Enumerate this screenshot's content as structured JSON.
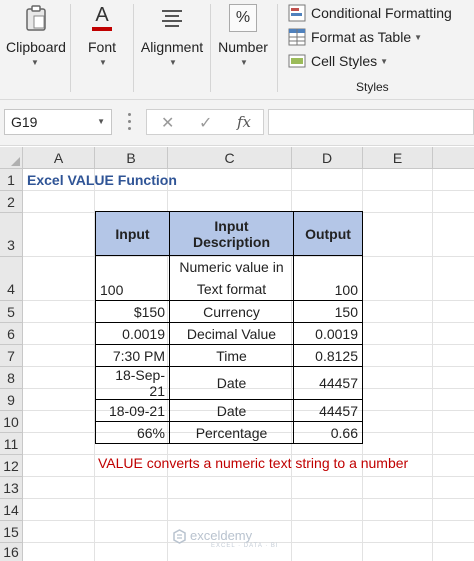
{
  "ribbon": {
    "groups": [
      {
        "label": "Clipboard",
        "icon": "clipboard-icon"
      },
      {
        "label": "Font",
        "icon": "font-icon"
      },
      {
        "label": "Alignment",
        "icon": "alignment-icon"
      },
      {
        "label": "Number",
        "icon": "percent-icon"
      }
    ],
    "styles": {
      "items": [
        "Conditional Formatting",
        "Format as Table",
        "Cell Styles"
      ],
      "group_label": "Styles"
    },
    "font_glyph": "A",
    "number_glyph": "%"
  },
  "formula_bar": {
    "name_box": "G19",
    "cancel_glyph": "✕",
    "enter_glyph": "✓",
    "fx_label": "fx",
    "formula": ""
  },
  "grid": {
    "columns": [
      "A",
      "B",
      "C",
      "D",
      "E"
    ],
    "rows": [
      "1",
      "2",
      "3",
      "4",
      "5",
      "6",
      "7",
      "8",
      "9",
      "10",
      "11",
      "12",
      "13",
      "14",
      "15",
      "16"
    ],
    "title": "Excel VALUE Function",
    "note": "VALUE converts a numeric text string to a number",
    "table": {
      "headers": [
        "Input",
        "Input Description",
        "Output"
      ],
      "rows": [
        {
          "input": "100",
          "desc_line1": "Numeric value in",
          "desc_line2": "Text format",
          "output": "100"
        },
        {
          "input": "$150",
          "desc": "Currency",
          "output": "150"
        },
        {
          "input": "0.0019",
          "desc": "Decimal Value",
          "output": "0.0019"
        },
        {
          "input": "7:30 PM",
          "desc": "Time",
          "output": "0.8125"
        },
        {
          "input": "18-Sep-21",
          "desc": "Date",
          "output": "44457"
        },
        {
          "input": "18-09-21",
          "desc": "Date",
          "output": "44457"
        },
        {
          "input": "66%",
          "desc": "Percentage",
          "output": "0.66"
        }
      ]
    }
  },
  "watermark": {
    "name": "exceldemy",
    "tagline": "EXCEL · DATA · BI"
  },
  "colors": {
    "title": "#2f5496",
    "note": "#c00000",
    "header_fill": "#b4c6e7"
  }
}
